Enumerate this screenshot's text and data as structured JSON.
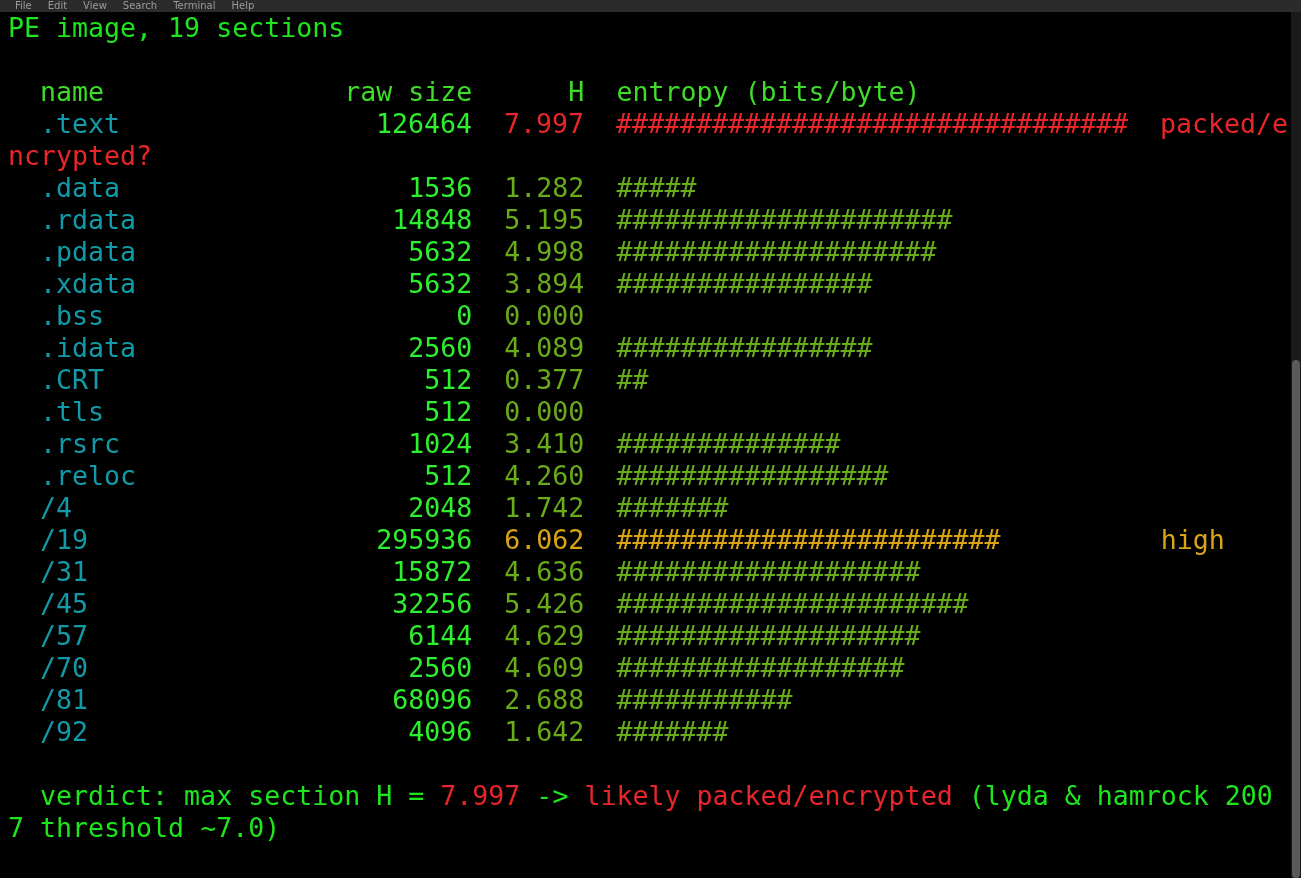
{
  "menu_bar": [
    "File",
    "Edit",
    "View",
    "Search",
    "Terminal",
    "Help"
  ],
  "title_line": "PE image, 19 sections",
  "columns": {
    "name": "name",
    "raw_size": "raw size",
    "h": "H",
    "entropy": "entropy (bits/byte)"
  },
  "sections": [
    {
      "name": ".text",
      "raw_size": "126464",
      "h": "7.997",
      "bar": "################################",
      "color": "#e8262a",
      "flag": "packed/encrypted?"
    },
    {
      "name": ".data",
      "raw_size": "1536",
      "h": "1.282",
      "bar": "#####",
      "color": "#6aab1a"
    },
    {
      "name": ".rdata",
      "raw_size": "14848",
      "h": "5.195",
      "bar": "#####################",
      "color": "#6aab1a"
    },
    {
      "name": ".pdata",
      "raw_size": "5632",
      "h": "4.998",
      "bar": "####################",
      "color": "#6aab1a"
    },
    {
      "name": ".xdata",
      "raw_size": "5632",
      "h": "3.894",
      "bar": "################",
      "color": "#6aab1a"
    },
    {
      "name": ".bss",
      "raw_size": "0",
      "h": "0.000",
      "color": "#6aab1a"
    },
    {
      "name": ".idata",
      "raw_size": "2560",
      "h": "4.089",
      "bar": "################",
      "color": "#6aab1a"
    },
    {
      "name": ".CRT",
      "raw_size": "512",
      "h": "0.377",
      "bar": "##",
      "color": "#6aab1a"
    },
    {
      "name": ".tls",
      "raw_size": "512",
      "h": "0.000",
      "color": "#6aab1a"
    },
    {
      "name": ".rsrc",
      "raw_size": "1024",
      "h": "3.410",
      "bar": "##############",
      "color": "#6aab1a"
    },
    {
      "name": ".reloc",
      "raw_size": "512",
      "h": "4.260",
      "bar": "#################",
      "color": "#6aab1a"
    },
    {
      "name": "/4",
      "raw_size": "2048",
      "h": "1.742",
      "bar": "#######",
      "color": "#6aab1a"
    },
    {
      "name": "/19",
      "raw_size": "295936",
      "h": "6.062",
      "bar": "########################",
      "color": "#d9a514",
      "flag": "high"
    },
    {
      "name": "/31",
      "raw_size": "15872",
      "h": "4.636",
      "bar": "###################",
      "color": "#6aab1a"
    },
    {
      "name": "/45",
      "raw_size": "32256",
      "h": "5.426",
      "bar": "######################",
      "color": "#6aab1a"
    },
    {
      "name": "/57",
      "raw_size": "6144",
      "h": "4.629",
      "bar": "###################",
      "color": "#6aab1a"
    },
    {
      "name": "/70",
      "raw_size": "2560",
      "h": "4.609",
      "bar": "##################",
      "color": "#6aab1a"
    },
    {
      "name": "/81",
      "raw_size": "68096",
      "h": "2.688",
      "bar": "###########",
      "color": "#6aab1a"
    },
    {
      "name": "/92",
      "raw_size": "4096",
      "h": "1.642",
      "bar": "#######",
      "color": "#6aab1a"
    }
  ],
  "verdict": [
    {
      "text": "verdict: max section H = ",
      "color": "#1ee61e"
    },
    {
      "text": "7.997",
      "color": "#e8262a"
    },
    {
      "text": " -> ",
      "color": "#1ee61e"
    },
    {
      "text": "likely packed/encrypted",
      "color": "#e8262a"
    },
    {
      "text": " (lyda & hamrock 2007 threshold ~7.0)",
      "color": "#1ee61e"
    }
  ]
}
